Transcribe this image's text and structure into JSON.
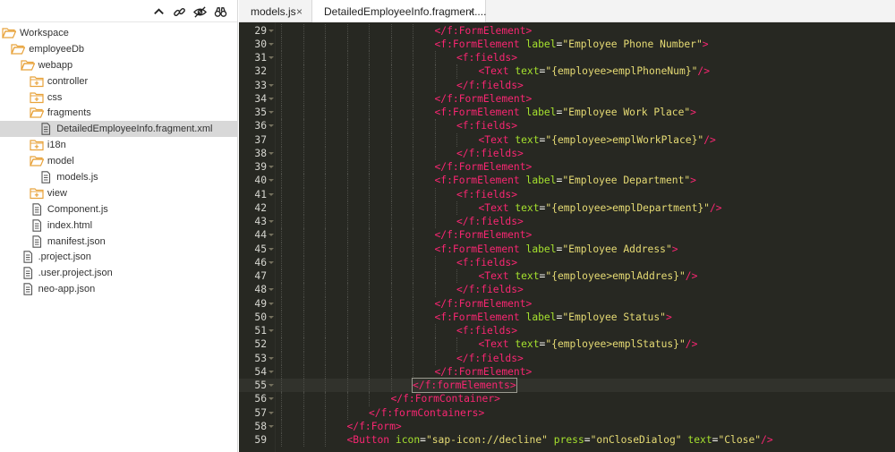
{
  "sidebar": {
    "toolbar": [
      {
        "name": "collapse-all-icon"
      },
      {
        "name": "link-editor-icon"
      },
      {
        "name": "hide-hidden-files-icon"
      },
      {
        "name": "search-binoculars-icon"
      }
    ],
    "tree": [
      {
        "label": "Workspace",
        "depth": 0,
        "icon": "folder-open",
        "selected": false
      },
      {
        "label": "employeeDb",
        "depth": 1,
        "icon": "folder-open",
        "selected": false
      },
      {
        "label": "webapp",
        "depth": 2,
        "icon": "folder-open",
        "selected": false
      },
      {
        "label": "controller",
        "depth": 3,
        "icon": "folder-closed",
        "selected": false
      },
      {
        "label": "css",
        "depth": 3,
        "icon": "folder-closed",
        "selected": false
      },
      {
        "label": "fragments",
        "depth": 3,
        "icon": "folder-open",
        "selected": false
      },
      {
        "label": "DetailedEmployeeInfo.fragment.xml",
        "depth": 4,
        "icon": "file",
        "selected": true
      },
      {
        "label": "i18n",
        "depth": 3,
        "icon": "folder-closed",
        "selected": false
      },
      {
        "label": "model",
        "depth": 3,
        "icon": "folder-open",
        "selected": false
      },
      {
        "label": "models.js",
        "depth": 4,
        "icon": "file",
        "selected": false
      },
      {
        "label": "view",
        "depth": 3,
        "icon": "folder-closed",
        "selected": false
      },
      {
        "label": "Component.js",
        "depth": 3,
        "icon": "file",
        "selected": false
      },
      {
        "label": "index.html",
        "depth": 3,
        "icon": "file",
        "selected": false
      },
      {
        "label": "manifest.json",
        "depth": 3,
        "icon": "file",
        "selected": false
      },
      {
        "label": ".project.json",
        "depth": 2,
        "icon": "file",
        "selected": false
      },
      {
        "label": ".user.project.json",
        "depth": 2,
        "icon": "file",
        "selected": false
      },
      {
        "label": "neo-app.json",
        "depth": 2,
        "icon": "file",
        "selected": false
      }
    ]
  },
  "tabs": [
    {
      "label": "models.js",
      "close": "×",
      "active": false
    },
    {
      "label": "DetailedEmployeeInfo.fragment....",
      "close": "×",
      "active": true
    }
  ],
  "editor": {
    "active_line": 55,
    "lines": [
      {
        "n": "29",
        "fold": true,
        "indent": 7,
        "text": "</f:FormElement>"
      },
      {
        "n": "30",
        "fold": true,
        "indent": 7,
        "text": "<f:FormElement label=\"Employee Phone Number\">"
      },
      {
        "n": "31",
        "fold": true,
        "indent": 8,
        "text": "<f:fields>"
      },
      {
        "n": "32",
        "fold": false,
        "indent": 9,
        "text": "<Text text=\"{employee>emplPhoneNum}\"/>"
      },
      {
        "n": "33",
        "fold": true,
        "indent": 8,
        "text": "</f:fields>"
      },
      {
        "n": "34",
        "fold": true,
        "indent": 7,
        "text": "</f:FormElement>"
      },
      {
        "n": "35",
        "fold": true,
        "indent": 7,
        "text": "<f:FormElement label=\"Employee Work Place\">"
      },
      {
        "n": "36",
        "fold": true,
        "indent": 8,
        "text": "<f:fields>"
      },
      {
        "n": "37",
        "fold": false,
        "indent": 9,
        "text": "<Text text=\"{employee>emplWorkPlace}\"/>"
      },
      {
        "n": "38",
        "fold": true,
        "indent": 8,
        "text": "</f:fields>"
      },
      {
        "n": "39",
        "fold": true,
        "indent": 7,
        "text": "</f:FormElement>"
      },
      {
        "n": "40",
        "fold": true,
        "indent": 7,
        "text": "<f:FormElement label=\"Employee Department\">"
      },
      {
        "n": "41",
        "fold": true,
        "indent": 8,
        "text": "<f:fields>"
      },
      {
        "n": "42",
        "fold": false,
        "indent": 9,
        "text": "<Text text=\"{employee>emplDepartment}\"/>"
      },
      {
        "n": "43",
        "fold": true,
        "indent": 8,
        "text": "</f:fields>"
      },
      {
        "n": "44",
        "fold": true,
        "indent": 7,
        "text": "</f:FormElement>"
      },
      {
        "n": "45",
        "fold": true,
        "indent": 7,
        "text": "<f:FormElement label=\"Employee Address\">"
      },
      {
        "n": "46",
        "fold": true,
        "indent": 8,
        "text": "<f:fields>"
      },
      {
        "n": "47",
        "fold": false,
        "indent": 9,
        "text": "<Text text=\"{employee>emplAddres}\"/>"
      },
      {
        "n": "48",
        "fold": true,
        "indent": 8,
        "text": "</f:fields>"
      },
      {
        "n": "49",
        "fold": true,
        "indent": 7,
        "text": "</f:FormElement>"
      },
      {
        "n": "50",
        "fold": true,
        "indent": 7,
        "text": "<f:FormElement label=\"Employee Status\">"
      },
      {
        "n": "51",
        "fold": true,
        "indent": 8,
        "text": "<f:fields>"
      },
      {
        "n": "52",
        "fold": false,
        "indent": 9,
        "text": "<Text text=\"{employee>emplStatus}\"/>"
      },
      {
        "n": "53",
        "fold": true,
        "indent": 8,
        "text": "</f:fields>"
      },
      {
        "n": "54",
        "fold": true,
        "indent": 7,
        "text": "</f:FormElement>"
      },
      {
        "n": "55",
        "fold": true,
        "indent": 6,
        "text": "</f:formElements>"
      },
      {
        "n": "56",
        "fold": true,
        "indent": 5,
        "text": "</f:FormContainer>"
      },
      {
        "n": "57",
        "fold": true,
        "indent": 4,
        "text": "</f:formContainers>"
      },
      {
        "n": "58",
        "fold": true,
        "indent": 3,
        "text": "</f:Form>"
      },
      {
        "n": "59",
        "fold": false,
        "indent": 3,
        "text": "<Button icon=\"sap-icon://decline\" press=\"onCloseDialog\" text=\"Close\"/>"
      }
    ]
  },
  "colors": {
    "editor_bg": "#272822",
    "tag": "#f92672",
    "attribute": "#a6e22e",
    "string": "#e6db74",
    "folder": "#e8a33c",
    "selection": "#d8d8d8"
  }
}
